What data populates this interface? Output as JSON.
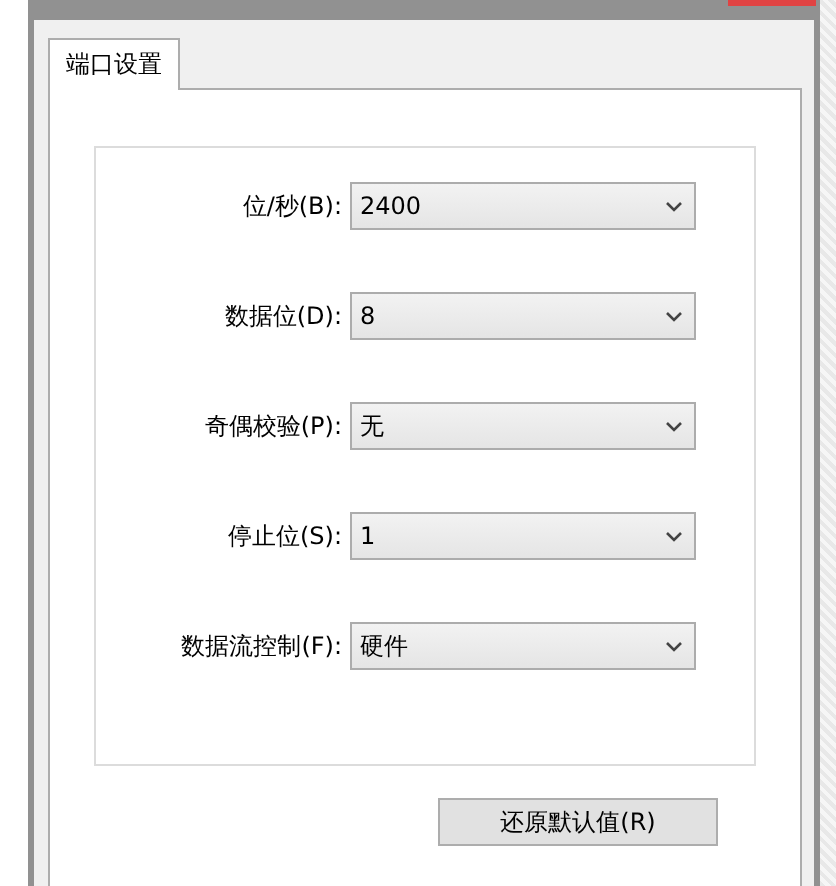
{
  "tabs": [
    {
      "label": "端口设置",
      "selected": true
    }
  ],
  "fields": [
    {
      "label": "位/秒(B):",
      "value": "2400"
    },
    {
      "label": "数据位(D):",
      "value": "8"
    },
    {
      "label": "奇偶校验(P):",
      "value": "无"
    },
    {
      "label": "停止位(S):",
      "value": "1"
    },
    {
      "label": "数据流控制(F):",
      "value": "硬件"
    }
  ],
  "buttons": [
    "还原默认值(R)"
  ]
}
